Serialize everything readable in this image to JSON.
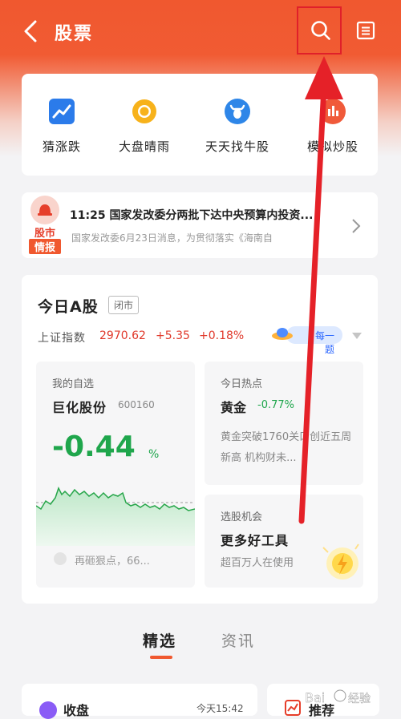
{
  "header": {
    "title": "股票",
    "colors": {
      "primary": "#f0582f",
      "annotation": "#e0202a"
    },
    "icons": {
      "back": "chevron-left-icon",
      "search": "search-icon",
      "menu": "menu-icon"
    }
  },
  "quick_entries": [
    {
      "label": "猜涨跌",
      "icon": "trend-chart-icon"
    },
    {
      "label": "大盘晴雨",
      "icon": "sun-icon"
    },
    {
      "label": "天天找牛股",
      "icon": "bull-icon"
    },
    {
      "label": "模拟炒股",
      "icon": "simulated-trading-icon"
    }
  ],
  "news": {
    "badge_top": "股市",
    "badge_bottom": "情报",
    "title": "11:25 国家发改委分两批下达中央预算内投资...",
    "summary": "国家发改委6月23日消息，为贯彻落实《海南自"
  },
  "market": {
    "title": "今日A股",
    "status": "闭市",
    "index_name": "上证指数",
    "index_value": "2970.62",
    "index_change": "+5.35",
    "index_pct": "+0.18%",
    "quiz_left": "每",
    "quiz_right": "一题",
    "favorites": {
      "caption": "我的自选",
      "stock_name": "巨化股份",
      "stock_code": "600160",
      "pct": "-0.44",
      "pct_unit": "%",
      "bottom_text": "再砸狠点，66..."
    },
    "hot": {
      "caption": "今日热点",
      "name": "黄金",
      "pct": "-0.77%",
      "desc": "黄金突破1760关口创近五周新高 机构财未..."
    },
    "opportunity": {
      "caption": "选股机会",
      "title": "更多好工具",
      "subtitle": "超百万人在使用"
    }
  },
  "tabs": [
    {
      "label": "精选",
      "active": true
    },
    {
      "label": "资讯",
      "active": false
    }
  ],
  "bottom_cards": [
    {
      "title": "收盘",
      "time": "今天15:42"
    },
    {
      "title": "推荐"
    }
  ],
  "watermark": "Bai 经验"
}
